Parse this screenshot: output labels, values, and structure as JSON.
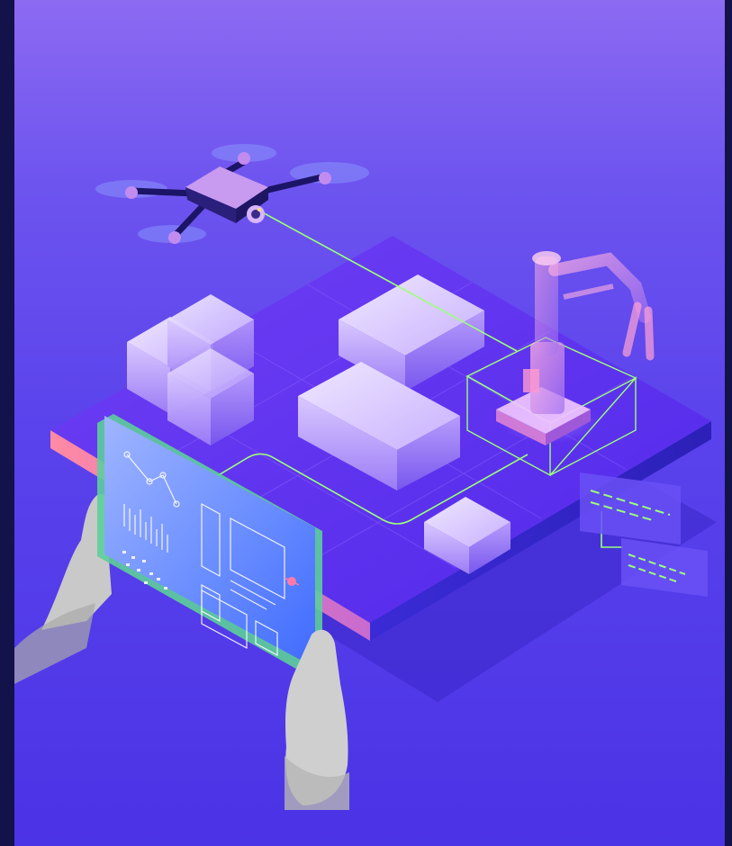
{
  "image": {
    "subject": "isometric-smart-factory-illustration",
    "colors": {
      "frame": "#14124a",
      "background_top": "#8c6af2",
      "background_bottom": "#4b33e6",
      "platform_top": "#6a3cf2",
      "platform_edge": "#ff8fb0",
      "cube": "#c9b3ff",
      "scan_line": "#9cff7a",
      "tablet": "#5f8dff"
    },
    "icons": [
      "drone-icon",
      "robot-arm-icon",
      "tablet-icon",
      "hand-icon"
    ]
  }
}
